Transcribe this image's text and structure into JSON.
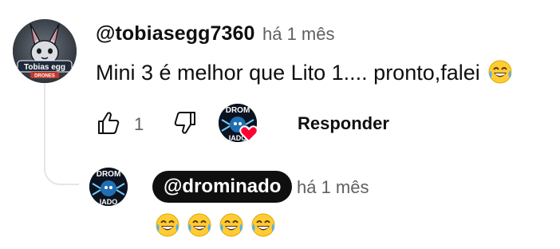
{
  "comment": {
    "author": "@tobiasegg7360",
    "time": "há 1 mês",
    "text": "Mini 3 é melhor que Lito 1.... pronto,falei",
    "avatar": {
      "label_top": "Tobias egg",
      "label_bottom": "DRONES",
      "icon": "rabbit-avatar-icon"
    },
    "actions": {
      "like_icon": "thumbs-up-icon",
      "like_count": "1",
      "dislike_icon": "thumbs-down-icon",
      "creator_heart_icon": "heart-icon",
      "reply_label": "Responder"
    }
  },
  "reply": {
    "author": "@drominado",
    "time": "há 1 mês",
    "avatar": {
      "label_top": "DROM",
      "label_bottom": "IADO"
    },
    "emoji_icon": "tears-of-joy-emoji",
    "emoji_count": 4
  },
  "colors": {
    "heart": "#ff0033",
    "secondary_text": "#606060",
    "thread_line": "#e5e5e5"
  }
}
